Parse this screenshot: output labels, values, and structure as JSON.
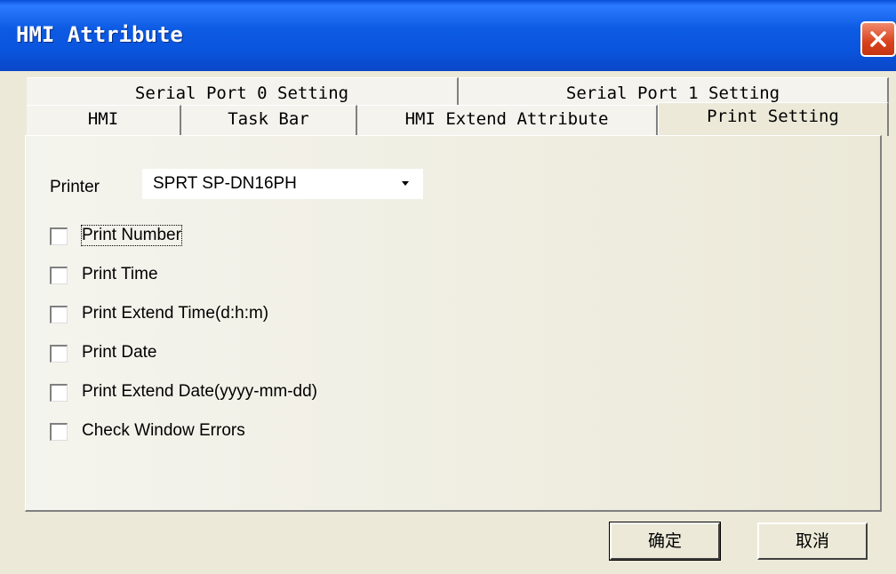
{
  "window": {
    "title": "HMI Attribute"
  },
  "tabs": {
    "row_back": [
      "Serial Port 0 Setting",
      "Serial Port 1 Setting"
    ],
    "row_front": [
      "HMI",
      "Task Bar",
      "HMI Extend Attribute",
      "Print Setting"
    ],
    "active": "Print Setting"
  },
  "printer": {
    "label": "Printer",
    "selected": "SPRT SP-DN16PH"
  },
  "options": [
    {
      "label": "Print Number",
      "checked": false
    },
    {
      "label": "Print Time",
      "checked": false
    },
    {
      "label": "Print Extend Time(d:h:m)",
      "checked": false
    },
    {
      "label": "Print Date",
      "checked": false
    },
    {
      "label": "Print Extend Date(yyyy-mm-dd)",
      "checked": false
    },
    {
      "label": "Check Window Errors",
      "checked": false
    }
  ],
  "buttons": {
    "ok": "确定",
    "cancel": "取消"
  }
}
